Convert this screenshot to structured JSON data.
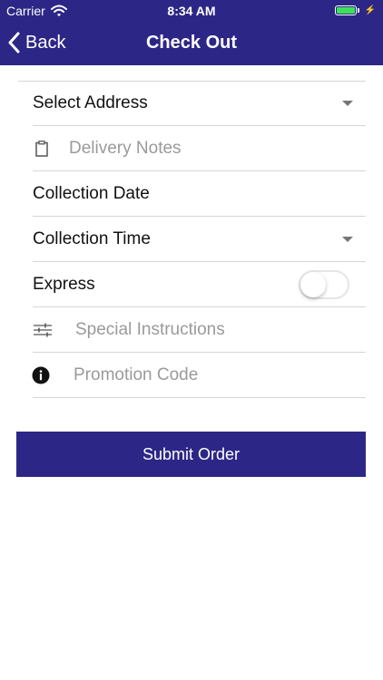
{
  "status_bar": {
    "carrier": "Carrier",
    "time": "8:34 AM",
    "battery_color": "#3ce25a"
  },
  "nav": {
    "back_label": "Back",
    "title": "Check Out",
    "bar_color": "#2c2786"
  },
  "form": {
    "address": {
      "label": "Select Address",
      "icon": "chevron-down-icon"
    },
    "delivery_notes": {
      "placeholder": "Delivery Notes",
      "value": "",
      "icon": "clipboard-icon"
    },
    "collection_date": {
      "label": "Collection Date"
    },
    "collection_time": {
      "label": "Collection Time",
      "icon": "chevron-down-icon"
    },
    "express": {
      "label": "Express",
      "enabled": false
    },
    "special_instructions": {
      "placeholder": "Special Instructions",
      "value": "",
      "icon": "sliders-icon"
    },
    "promotion_code": {
      "placeholder": "Promotion Code",
      "value": "",
      "icon": "info-icon"
    }
  },
  "submit": {
    "label": "Submit Order",
    "color": "#2c2786"
  }
}
